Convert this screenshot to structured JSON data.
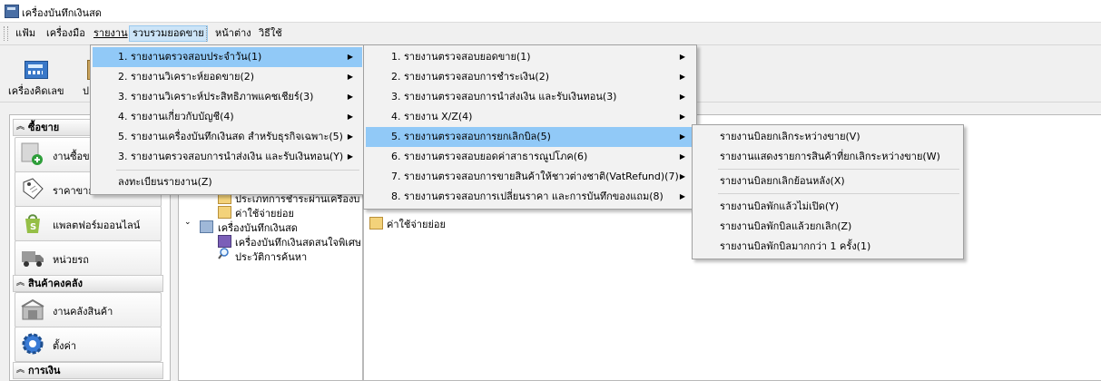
{
  "window": {
    "title": "เครื่องบันทึกเงินสด"
  },
  "menubar": {
    "items": [
      "แฟ้ม",
      "เครื่องมือ",
      "รายงาน",
      "รวบรวมยอดขาย",
      "หน้าต่าง",
      "วิธีใช้"
    ]
  },
  "toolbar": {
    "calculator_label": "เครื่องคิดเลข",
    "partial_label": "ป"
  },
  "sidebar": {
    "sections": [
      "ซื้อขาย",
      "สินค้าคงคลัง",
      "การเงิน"
    ],
    "items": [
      "งานซื้อข",
      "ราคาขาย",
      "แพลตฟอร์มออนไลน์",
      "หน่วยรถ",
      "งานคลังสินค้า",
      "ตั้งค่า"
    ]
  },
  "tree": {
    "items": [
      "ประเภทการชำระผ่านเครื่องบน",
      "ค่าใช้จ่ายย่อย",
      "เครื่องบันทึกเงินสด",
      "เครื่องบันทึกเงินสดสนใจพิเศษ",
      "ประวัติการค้นหา"
    ]
  },
  "list": {
    "items": [
      "ค่าใช้จ่ายย่อย"
    ]
  },
  "menu_report": {
    "items": [
      "1. รายงานตรวจสอบประจำวัน(1)",
      "2. รายงานวิเคราะห์ยอดขาย(2)",
      "3. รายงานวิเคราะห์ประสิทธิภาพแคชเชียร์(3)",
      "4. รายงานเกี่ยวกับบัญชี(4)",
      "5. รายงานเครื่องบันทึกเงินสด สำหรับธุรกิจเฉพาะ(5)",
      "3. รายงานตรวจสอบการนำส่งเงิน และรับเงินทอน(Y)",
      "ลงทะเบียนรายงาน(Z)"
    ]
  },
  "menu_daily": {
    "items": [
      "1. รายงานตรวจสอบยอดขาย(1)",
      "2. รายงานตรวจสอบการชำระเงิน(2)",
      "3. รายงานตรวจสอบการนำส่งเงิน และรับเงินทอน(3)",
      "4. รายงาน X/Z(4)",
      "5. รายงานตรวจสอบการยกเลิกบิล(5)",
      "6. รายงานตรวจสอบยอดค่าสาธารณูปโภค(6)",
      "7. รายงานตรวจสอบการขายสินค้าให้ชาวต่างชาติ(VatRefund)(7)",
      "8. รายงานตรวจสอบการเปลี่ยนราคา และการบันทึกของแถม(8)"
    ]
  },
  "menu_cancel": {
    "items": [
      "รายงานบิลยกเลิกระหว่างขาย(V)",
      "รายงานแสดงรายการสินค้าที่ยกเลิกระหว่างขาย(W)",
      "รายงานบิลยกเลิกย้อนหลัง(X)",
      "รายงานบิลพักแล้วไม่เปิด(Y)",
      "รายงานบิลพักบิลแล้วยกเลิก(Z)",
      "รายงานบิลพักบิลมากกว่า 1 ครั้ง(1)"
    ]
  }
}
